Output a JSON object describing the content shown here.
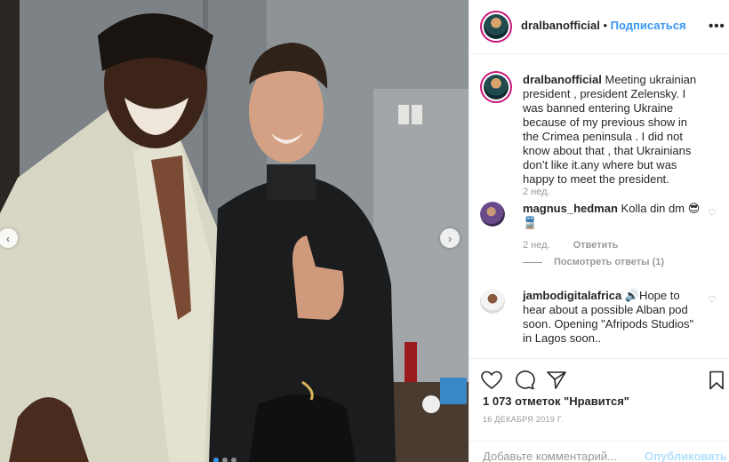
{
  "header": {
    "username": "dralbanofficial",
    "separator": " • ",
    "follow_label": "Подписаться",
    "more_label": "•••"
  },
  "photo": {
    "prev_label": "‹",
    "next_label": "›",
    "carousel_dots": 3,
    "active_dot": 1
  },
  "caption": {
    "username": "dralbanofficial",
    "text": "Meeting ukrainian president , president Zelensky. I was banned entering Ukraine because of my previous show in the Crimea peninsula . I did not know about that , that Ukrainians don’t like it.any where but was happy to meet the president.",
    "time": "2 нед."
  },
  "comments": [
    {
      "username": "magnus_hedman",
      "text": "Kolla din dm 😎🚆",
      "time": "2 нед.",
      "reply_label": "Ответить",
      "view_replies": "Посмотреть ответы (1)"
    },
    {
      "username": "jambodigitalafrica",
      "text": "🔊Hope to hear about a possible Alban pod soon. Opening \"Afripods Studios\" in Lagos soon.."
    }
  ],
  "actions": {
    "likes": "1 073 отметок \"Нравится\"",
    "date": "16 ДЕКАБРЯ 2019 Г."
  },
  "composer": {
    "placeholder": "Добавьте комментарий...",
    "post_label": "Опубликовать"
  },
  "icons": [
    "heart-icon",
    "comment-icon",
    "share-icon",
    "bookmark-icon",
    "chevron-left-icon",
    "chevron-right-icon",
    "more-icon"
  ],
  "colors": {
    "link": "#3897f0",
    "muted": "#999999",
    "border": "#efefef",
    "post_disabled": "#b2dffc"
  }
}
